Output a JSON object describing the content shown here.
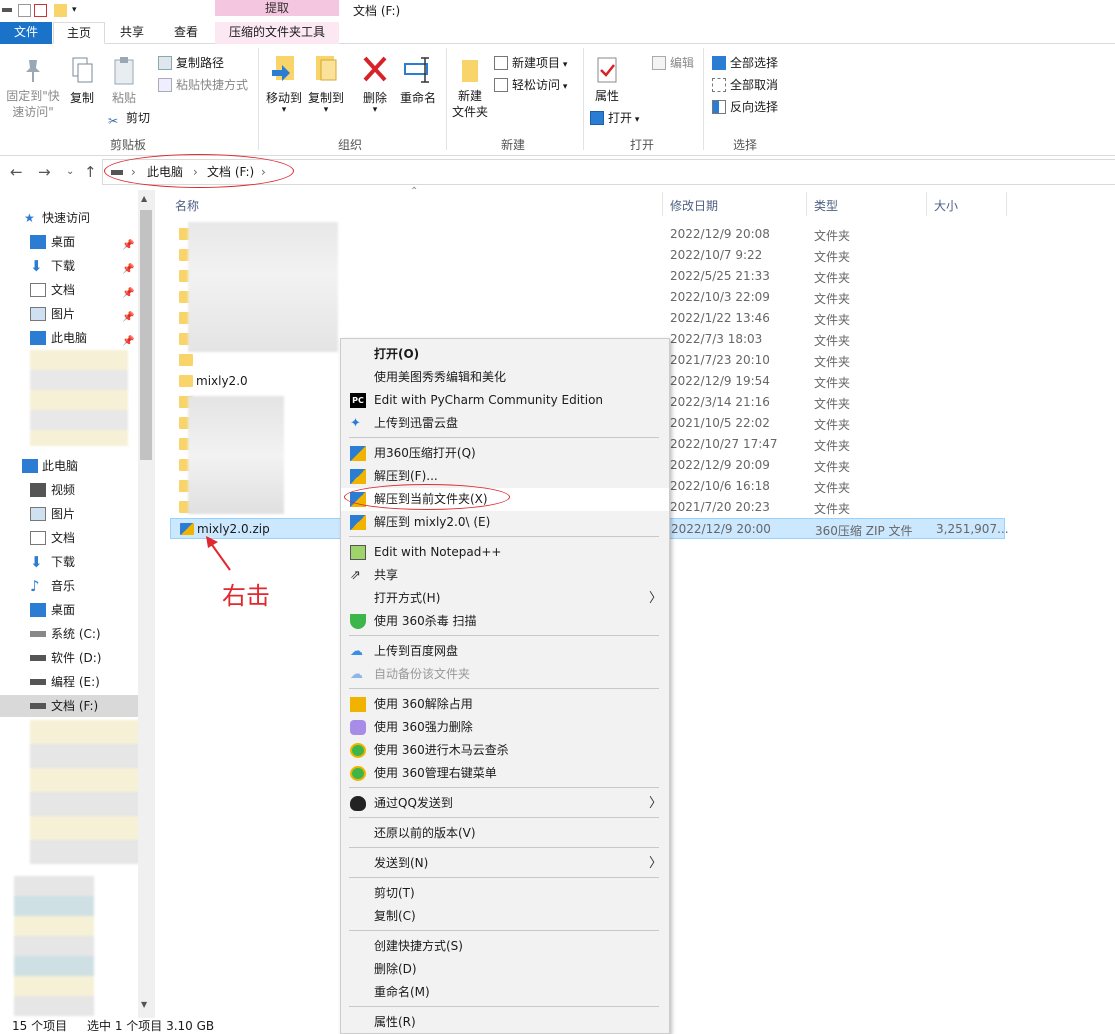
{
  "window": {
    "title": "文档 (F:)",
    "context_tab_header": "提取"
  },
  "tabs": {
    "file": "文件",
    "home": "主页",
    "share": "共享",
    "view": "查看",
    "zip_tools": "压缩的文件夹工具"
  },
  "ribbon": {
    "clipboard": {
      "pin_line1": "固定到\"快",
      "pin_line2": "速访问\"",
      "copy": "复制",
      "paste": "粘贴",
      "copy_path": "复制路径",
      "paste_shortcut": "粘贴快捷方式",
      "cut": "剪切",
      "label": "剪贴板"
    },
    "organize": {
      "move_to": "移动到",
      "copy_to": "复制到",
      "delete": "删除",
      "rename": "重命名",
      "label": "组织"
    },
    "new": {
      "new_folder_line1": "新建",
      "new_folder_line2": "文件夹",
      "new_item": "新建项目",
      "easy_access": "轻松访问",
      "label": "新建"
    },
    "open": {
      "properties": "属性",
      "open": "打开",
      "edit": "编辑",
      "label": "打开"
    },
    "select": {
      "select_all": "全部选择",
      "select_none": "全部取消",
      "invert": "反向选择",
      "label": "选择"
    }
  },
  "address": {
    "crumbs": [
      "此电脑",
      "文档 (F:)"
    ]
  },
  "navpane": {
    "quick_access": "快速访问",
    "quick_items": [
      "桌面",
      "下载",
      "文档",
      "图片",
      "此电脑"
    ],
    "this_pc": "此电脑",
    "pc_items": [
      "视频",
      "图片",
      "文档",
      "下载",
      "音乐",
      "桌面",
      "系统 (C:)",
      "软件 (D:)",
      "编程 (E:)",
      "文档 (F:)"
    ]
  },
  "columns": {
    "name": "名称",
    "date": "修改日期",
    "type": "类型",
    "size": "大小"
  },
  "files": [
    {
      "name": "",
      "date": "2022/12/9 20:08",
      "type": "文件夹",
      "size": ""
    },
    {
      "name": "",
      "date": "2022/10/7 9:22",
      "type": "文件夹",
      "size": ""
    },
    {
      "name": "",
      "date": "2022/5/25 21:33",
      "type": "文件夹",
      "size": ""
    },
    {
      "name": "",
      "date": "2022/10/3 22:09",
      "type": "文件夹",
      "size": ""
    },
    {
      "name": "",
      "date": "2022/1/22 13:46",
      "type": "文件夹",
      "size": ""
    },
    {
      "name": "",
      "date": "2022/7/3 18:03",
      "type": "文件夹",
      "size": ""
    },
    {
      "name": "",
      "date": "2021/7/23 20:10",
      "type": "文件夹",
      "size": ""
    },
    {
      "name": "mixly2.0",
      "date": "2022/12/9 19:54",
      "type": "文件夹",
      "size": ""
    },
    {
      "name": "",
      "date": "2022/3/14 21:16",
      "type": "文件夹",
      "size": ""
    },
    {
      "name": "",
      "date": "2021/10/5 22:02",
      "type": "文件夹",
      "size": ""
    },
    {
      "name": "",
      "date": "2022/10/27 17:47",
      "type": "文件夹",
      "size": ""
    },
    {
      "name": "",
      "date": "2022/12/9 20:09",
      "type": "文件夹",
      "size": ""
    },
    {
      "name": "",
      "date": "2022/10/6 16:18",
      "type": "文件夹",
      "size": ""
    },
    {
      "name": "",
      "date": "2021/7/20 20:23",
      "type": "文件夹",
      "size": ""
    },
    {
      "name": "mixly2.0.zip",
      "date": "2022/12/9 20:00",
      "type": "360压缩 ZIP 文件",
      "size": "3,251,907..."
    }
  ],
  "status": {
    "count": "15 个项目",
    "selected": "选中 1 个项目  3.10 GB"
  },
  "context_menu": {
    "open": "打开(O)",
    "meitu": "使用美图秀秀编辑和美化",
    "pycharm": "Edit with PyCharm Community Edition",
    "xunlei": "上传到迅雷云盘",
    "open_360zip": "用360压缩打开(Q)",
    "extract_to": "解压到(F)...",
    "extract_here": "解压到当前文件夹(X)",
    "extract_named": "解压到 mixly2.0\\ (E)",
    "notepad": "Edit with Notepad++",
    "share": "共享",
    "open_with": "打开方式(H)",
    "scan360": "使用 360杀毒 扫描",
    "baidu": "上传到百度网盘",
    "backup": "自动备份该文件夹",
    "unlock360": "使用 360解除占用",
    "force_delete": "使用 360强力删除",
    "trojan": "使用 360进行木马云查杀",
    "rmenu": "使用 360管理右键菜单",
    "qq": "通过QQ发送到",
    "restore": "还原以前的版本(V)",
    "send_to": "发送到(N)",
    "cut": "剪切(T)",
    "copy": "复制(C)",
    "shortcut": "创建快捷方式(S)",
    "delete": "删除(D)",
    "rename": "重命名(M)",
    "properties": "属性(R)"
  },
  "annotation": {
    "text": "右击"
  },
  "colors": {
    "accent": "#1a73c8",
    "annotation": "#e0282e",
    "selection": "#cce8ff"
  }
}
